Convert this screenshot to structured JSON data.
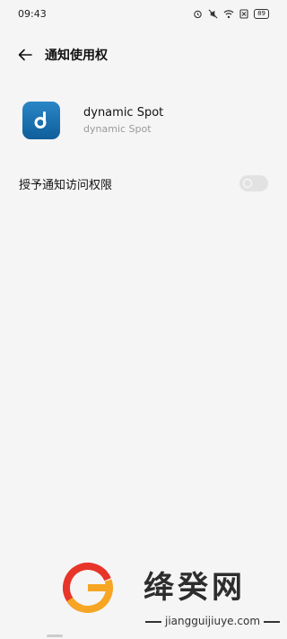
{
  "status": {
    "time": "09:43",
    "battery": "89"
  },
  "header": {
    "title": "通知使用权"
  },
  "app": {
    "name": "dynamic Spot",
    "package": "dynamic Spot",
    "icon_letter": "d",
    "icon_color": "#1a73b5"
  },
  "setting": {
    "label": "授予通知访问权限",
    "toggle_on": false
  },
  "watermark": {
    "title": "绛癸网",
    "url": "jiangguijiuye.com"
  }
}
